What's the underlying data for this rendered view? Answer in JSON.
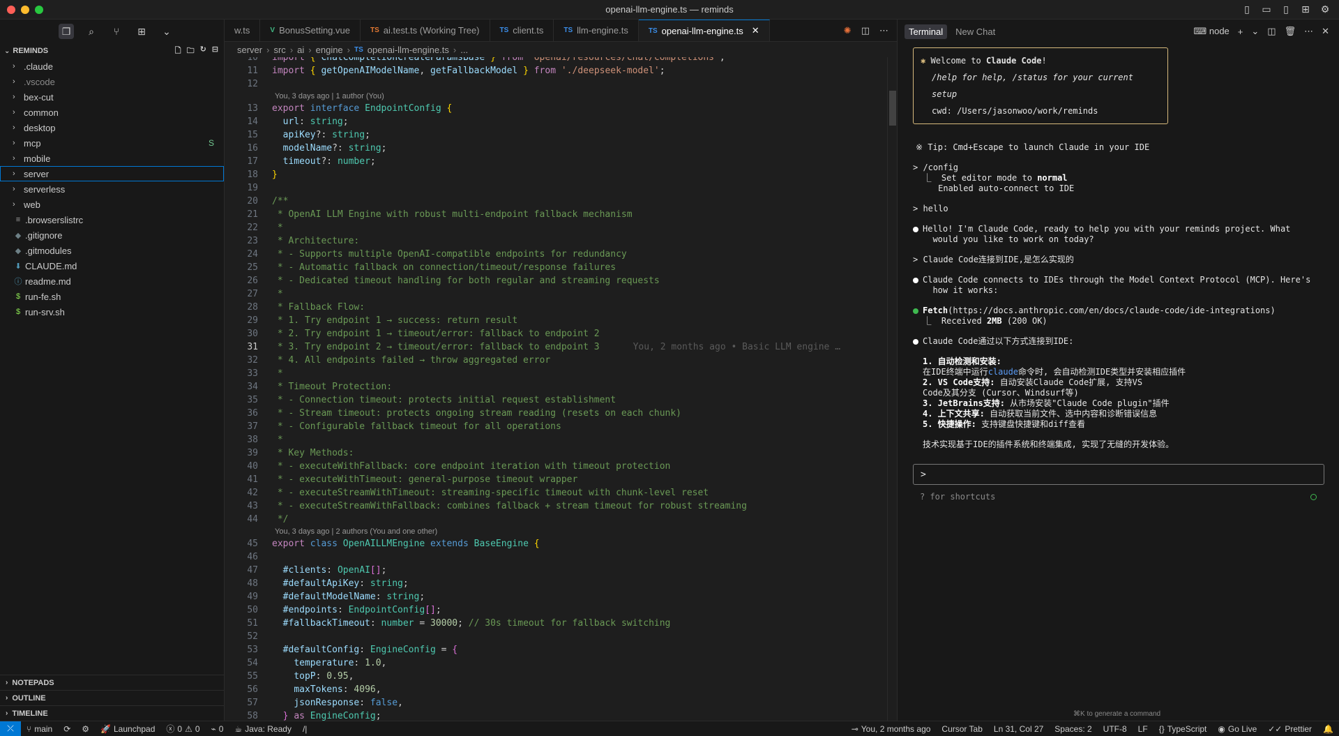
{
  "window": {
    "title": "openai-llm-engine.ts — reminds"
  },
  "sidebar": {
    "explorer_title": "REMINDS",
    "tree": [
      {
        "label": ".claude",
        "type": "folder"
      },
      {
        "label": ".vscode",
        "type": "folder",
        "muted": true
      },
      {
        "label": "bex-cut",
        "type": "folder"
      },
      {
        "label": "common",
        "type": "folder"
      },
      {
        "label": "desktop",
        "type": "folder"
      },
      {
        "label": "mcp",
        "type": "folder",
        "badge": "S"
      },
      {
        "label": "mobile",
        "type": "folder"
      },
      {
        "label": "server",
        "type": "folder",
        "selected": true
      },
      {
        "label": "serverless",
        "type": "folder"
      },
      {
        "label": "web",
        "type": "folder"
      },
      {
        "label": ".browserslistrc",
        "type": "file",
        "icon": "≡"
      },
      {
        "label": ".gitignore",
        "type": "file",
        "icon": "◆"
      },
      {
        "label": ".gitmodules",
        "type": "file",
        "icon": "◆"
      },
      {
        "label": "CLAUDE.md",
        "type": "file",
        "icon": "⬇"
      },
      {
        "label": "readme.md",
        "type": "file",
        "icon": "ⓘ"
      },
      {
        "label": "run-fe.sh",
        "type": "file",
        "icon": "$"
      },
      {
        "label": "run-srv.sh",
        "type": "file",
        "icon": "$"
      }
    ],
    "sections": {
      "notepads": "NOTEPADS",
      "outline": "OUTLINE",
      "timeline": "TIMELINE"
    }
  },
  "tabs": [
    {
      "label": "w.ts",
      "icon": "",
      "color": "#9d9d9d"
    },
    {
      "label": "BonusSetting.vue",
      "icon": "V",
      "color": "#41b883"
    },
    {
      "label": "ai.test.ts (Working Tree)",
      "icon": "TS",
      "color": "#e37933"
    },
    {
      "label": "client.ts",
      "icon": "TS",
      "color": "#3b8eea"
    },
    {
      "label": "llm-engine.ts",
      "icon": "TS",
      "color": "#3b8eea"
    },
    {
      "label": "openai-llm-engine.ts",
      "icon": "TS",
      "color": "#3b8eea",
      "active": true
    }
  ],
  "breadcrumb": [
    "server",
    "src",
    "ai",
    "engine",
    "openai-llm-engine.ts",
    "..."
  ],
  "code": {
    "lens_1": "You, 3 days ago | 1 author (You)",
    "lens_2": "You, 3 days ago | 2 authors (You and one other)",
    "blame": "You, 2 months ago • Basic LLM engine …",
    "line_10": "import { ChatCompletionCreateParamsBase } from 'openai/resources/chat/completions';",
    "line_11": "import { getOpenAIModelName, getFallbackModel } from './deepseek-model';",
    "line_13": "export interface EndpointConfig {",
    "line_14": "  url: string;",
    "line_15": "  apiKey?: string;",
    "line_16": "  modelName?: string;",
    "line_17": "  timeout?: number;",
    "line_18": "}",
    "line_20": "/**",
    "line_21": " * OpenAI LLM Engine with robust multi-endpoint fallback mechanism",
    "line_22": " *",
    "line_23": " * Architecture:",
    "line_24": " * - Supports multiple OpenAI-compatible endpoints for redundancy",
    "line_25": " * - Automatic fallback on connection/timeout/response failures",
    "line_26": " * - Dedicated timeout handling for both regular and streaming requests",
    "line_27": " *",
    "line_28": " * Fallback Flow:",
    "line_29": " * 1. Try endpoint 1 → success: return result",
    "line_30": " * 2. Try endpoint 1 → timeout/error: fallback to endpoint 2",
    "line_31": " * 3. Try endpoint 2 → timeout/error: fallback to endpoint 3",
    "line_32": " * 4. All endpoints failed → throw aggregated error",
    "line_33": " *",
    "line_34": " * Timeout Protection:",
    "line_35": " * - Connection timeout: protects initial request establishment",
    "line_36": " * - Stream timeout: protects ongoing stream reading (resets on each chunk)",
    "line_37": " * - Configurable fallback timeout for all operations",
    "line_38": " *",
    "line_39": " * Key Methods:",
    "line_40": " * - executeWithFallback: core endpoint iteration with timeout protection",
    "line_41": " * - executeWithTimeout: general-purpose timeout wrapper",
    "line_42": " * - executeStreamWithTimeout: streaming-specific timeout with chunk-level reset",
    "line_43": " * - executeStreamWithFallback: combines fallback + stream timeout for robust streaming",
    "line_44": " */",
    "line_45": "export class OpenAILLMEngine extends BaseEngine {",
    "line_47": "  #clients: OpenAI[];",
    "line_48": "  #defaultApiKey: string;",
    "line_49": "  #defaultModelName: string;",
    "line_50": "  #endpoints: EndpointConfig[];",
    "line_51": "  #fallbackTimeout: number = 30000; // 30s timeout for fallback switching",
    "line_53": "  #defaultConfig: EngineConfig = {",
    "line_54": "    temperature: 1.0,",
    "line_55": "    topP: 0.95,",
    "line_56": "    maxTokens: 4096,",
    "line_57": "    jsonResponse: false,",
    "line_58": "  } as EngineConfig;"
  },
  "panel": {
    "tabs": [
      "Terminal",
      "New Chat"
    ],
    "shell": "node",
    "welcome_title": "Welcome to",
    "welcome_brand": "Claude Code",
    "welcome_help": "/help for help, /status for your current setup",
    "welcome_cwd": "cwd: /Users/jasonwoo/work/reminds",
    "tip": "※ Tip: Cmd+Escape to launch Claude in your IDE",
    "cmd_config": "> /config",
    "config_line1_prefix": "  ⎿  Set editor mode to",
    "config_line1_value": "normal",
    "config_line2": "     Enabled auto-connect to IDE",
    "cmd_hello": "> hello",
    "resp_hello": "Hello! I'm Claude Code, ready to help you with your reminds project. What\n  would you like to work on today?",
    "cmd_question": "> Claude Code连接到IDE,是怎么实现的",
    "resp_mcp": "Claude Code connects to IDEs through the Model Context Protocol (MCP). Here's\n  how it works:",
    "fetch_label": "Fetch",
    "fetch_url": "(https://docs.anthropic.com/en/docs/claude-code/ide-integrations)",
    "fetch_result_prefix": "  ⎿  Received",
    "fetch_result_size": "2MB",
    "fetch_result_suffix": "(200 OK)",
    "resp_ways": "Claude Code通过以下方式连接到IDE:",
    "step1_title": "1. 自动检测和安装:",
    "step1_a": "在IDE终端中运行",
    "step1_cmd": "claude",
    "step1_b": "命令时, 会自动检测IDE类型并安装相应插件",
    "step2_title": "2. VS Code支持:",
    "step2_body": " 自动安装Claude Code扩展, 支持VS\nCode及其分支 (Cursor、Windsurf等)",
    "step3_title": "3. JetBrains支持:",
    "step3_body": " 从市场安装\"Claude Code plugin\"插件",
    "step4_title": "4. 上下文共享:",
    "step4_body": " 自动获取当前文件、选中内容和诊断错误信息",
    "step5_title": "5. 快捷操作:",
    "step5_body": " 支持键盘快捷键和diff查看",
    "summary": "技术实现基于IDE的插件系统和终端集成, 实现了无缝的开发体验。",
    "prompt": ">",
    "shortcut_hint": "? for shortcuts",
    "gen_command": "⌘K to generate a command"
  },
  "status": {
    "branch": "main",
    "launchpad": "Launchpad",
    "errors": "0",
    "warnings": "0",
    "ports": "0",
    "java": "Java: Ready",
    "blame": "You, 2 months ago",
    "cursor_tab": "Cursor Tab",
    "position": "Ln 31, Col 27",
    "spaces": "Spaces: 2",
    "encoding": "UTF-8",
    "eol": "LF",
    "language": "TypeScript",
    "golive": "Go Live",
    "prettier": "Prettier"
  },
  "colors": {
    "accent": "#0078d4",
    "welcome_border": "#d7ba7d",
    "close": "#ff5f57",
    "minimize": "#febc2e",
    "maximize": "#28c840"
  }
}
